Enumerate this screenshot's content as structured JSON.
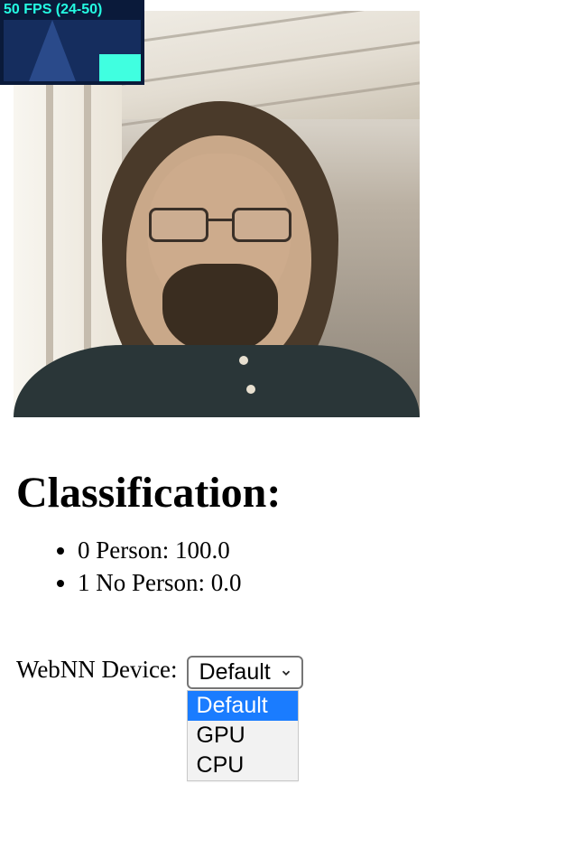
{
  "fps": {
    "text": "50 FPS (24-50)"
  },
  "video": {
    "description": "webcam-feed"
  },
  "classification": {
    "heading": "Classification:",
    "results": [
      {
        "text": "0 Person: 100.0"
      },
      {
        "text": "1 No Person: 0.0"
      }
    ]
  },
  "device": {
    "label": "WebNN Device:",
    "selected": "Default",
    "options": [
      "Default",
      "GPU",
      "CPU"
    ]
  }
}
